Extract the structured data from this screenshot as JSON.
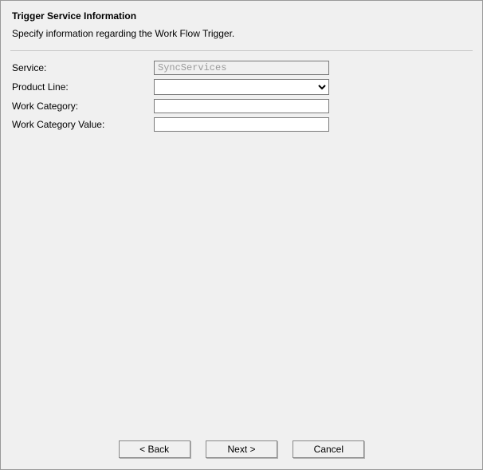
{
  "header": {
    "title": "Trigger Service Information",
    "subtitle": "Specify information regarding the Work Flow Trigger."
  },
  "form": {
    "service": {
      "label": "Service:",
      "value": "SyncServices"
    },
    "product_line": {
      "label": "Product Line:",
      "value": ""
    },
    "work_category": {
      "label": "Work Category:",
      "value": ""
    },
    "work_category_value": {
      "label": "Work Category Value:",
      "value": ""
    }
  },
  "buttons": {
    "back": "< Back",
    "next": "Next >",
    "cancel": "Cancel"
  }
}
